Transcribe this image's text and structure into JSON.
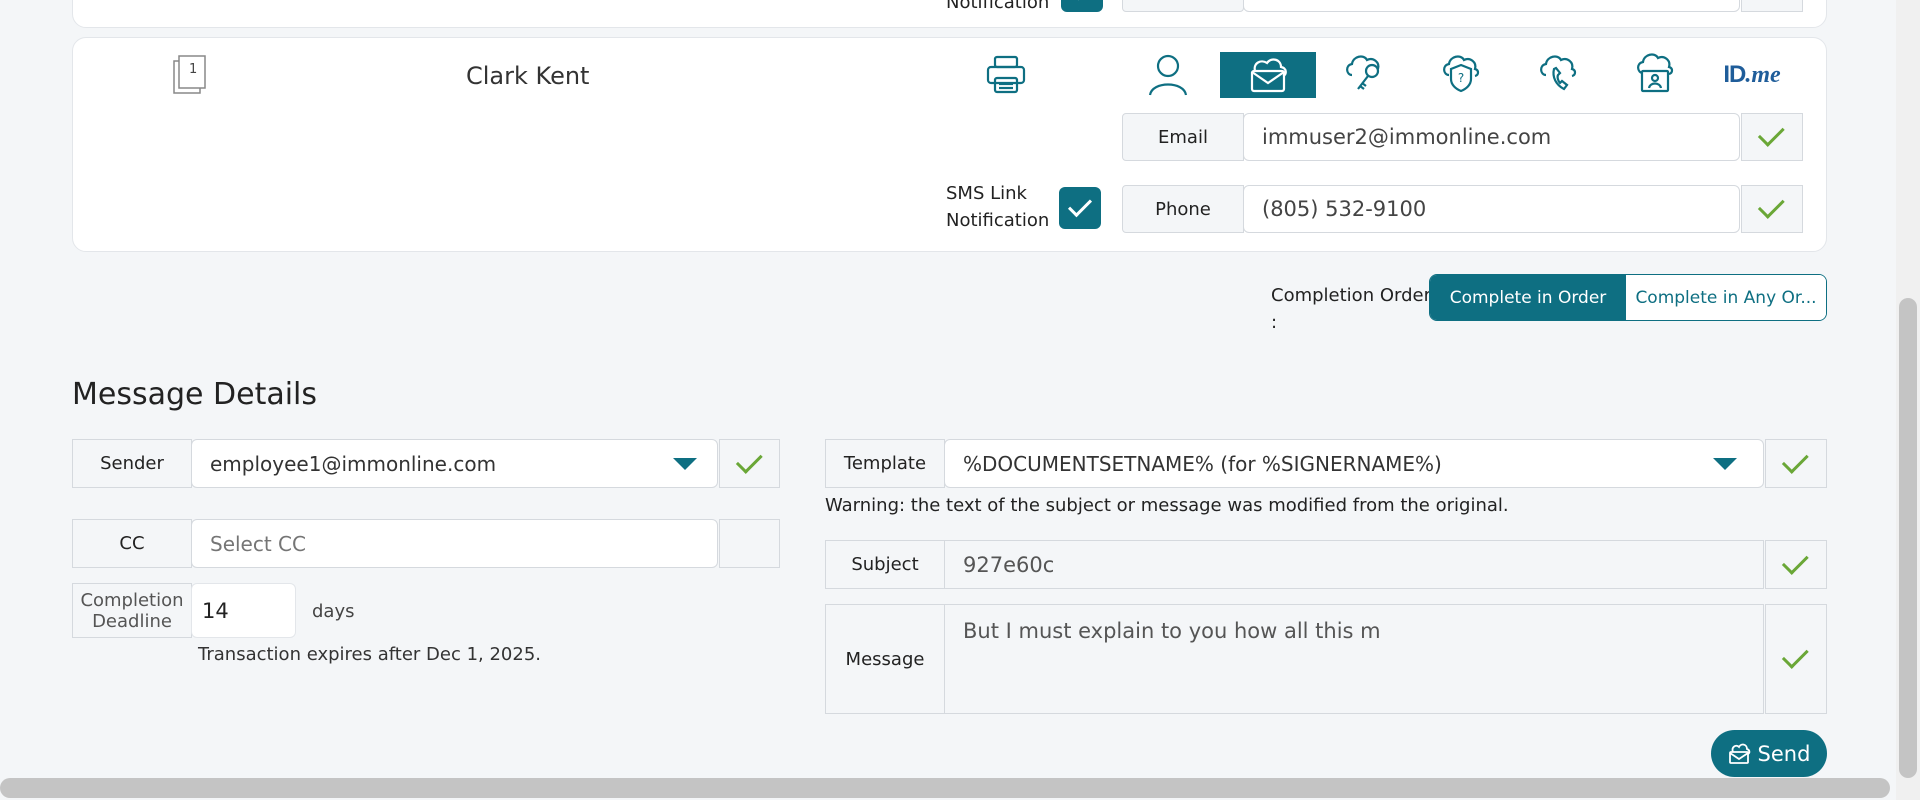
{
  "top_partial": {
    "notification_label": "Notification"
  },
  "signer": {
    "doc_count": "1",
    "name": "Clark Kent",
    "auth_icons": [
      "printer-icon",
      "person-icon",
      "email-envelope-icon",
      "cloud-key-icon",
      "cloud-question-shield-icon",
      "cloud-phone-icon",
      "cloud-id-card-icon"
    ],
    "idme": {
      "id": "ID",
      "me": ".me"
    },
    "email_label": "Email",
    "email_value": "immuser2@immonline.com",
    "sms_label_1": "SMS Link",
    "sms_label_2": "Notification",
    "phone_label": "Phone",
    "phone_value": "(805) 532-9100"
  },
  "completion_order": {
    "label_1": "Completion Order",
    "label_2": ":",
    "options": [
      "Complete in Order",
      "Complete in Any Or..."
    ]
  },
  "message_details": {
    "heading": "Message Details",
    "sender_label": "Sender",
    "sender_value": "employee1@immonline.com",
    "cc_label": "CC",
    "cc_placeholder": "Select CC",
    "deadline_label_1": "Completion",
    "deadline_label_2": "Deadline",
    "deadline_value": "14",
    "deadline_unit": "days",
    "expiry_note": "Transaction expires after Dec 1, 2025.",
    "template_label": "Template",
    "template_value": "%DOCUMENTSETNAME% (for %SIGNERNAME%)",
    "warning": "Warning: the text of the subject or message was modified from the original.",
    "subject_label": "Subject",
    "subject_value": "927e60c",
    "message_label": "Message",
    "message_value": "But I must explain to you how all this m",
    "send_label": "Send"
  },
  "colors": {
    "accent": "#0e6f82",
    "check_green": "#6aa737",
    "background": "#f4f6f8"
  }
}
